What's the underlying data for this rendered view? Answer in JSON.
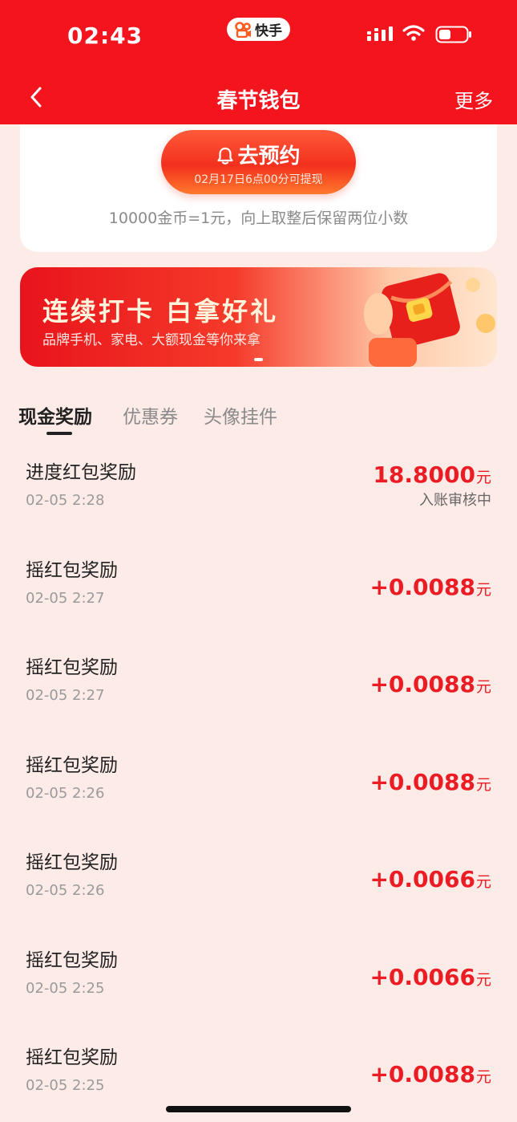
{
  "status_bar": {
    "time": "02:43",
    "app_badge": "快手"
  },
  "nav": {
    "title": "春节钱包",
    "more": "更多"
  },
  "reserve": {
    "label": "去预约",
    "sub": "02月17日6点00分可提现",
    "rate_note": "10000金币=1元，向上取整后保留两位小数"
  },
  "banner": {
    "title": "连续打卡 白拿好礼",
    "subtitle": "品牌手机、家电、大额现金等你来拿"
  },
  "tabs": [
    {
      "label": "现金奖励",
      "active": true
    },
    {
      "label": "优惠券",
      "active": false
    },
    {
      "label": "头像挂件",
      "active": false
    }
  ],
  "currency_unit": "元",
  "records": [
    {
      "title": "进度红包奖励",
      "time": "02-05 2:28",
      "amount": "18.8000",
      "status": "入账审核中"
    },
    {
      "title": "摇红包奖励",
      "time": "02-05 2:27",
      "amount": "+0.0088"
    },
    {
      "title": "摇红包奖励",
      "time": "02-05 2:27",
      "amount": "+0.0088"
    },
    {
      "title": "摇红包奖励",
      "time": "02-05 2:26",
      "amount": "+0.0088"
    },
    {
      "title": "摇红包奖励",
      "time": "02-05 2:26",
      "amount": "+0.0066"
    },
    {
      "title": "摇红包奖励",
      "time": "02-05 2:25",
      "amount": "+0.0066"
    },
    {
      "title": "摇红包奖励",
      "time": "02-05 2:25",
      "amount": "+0.0088"
    }
  ],
  "colors": {
    "brand_red": "#f4141e",
    "amount_red": "#ec1c24",
    "page_bg": "#fdebe8"
  }
}
